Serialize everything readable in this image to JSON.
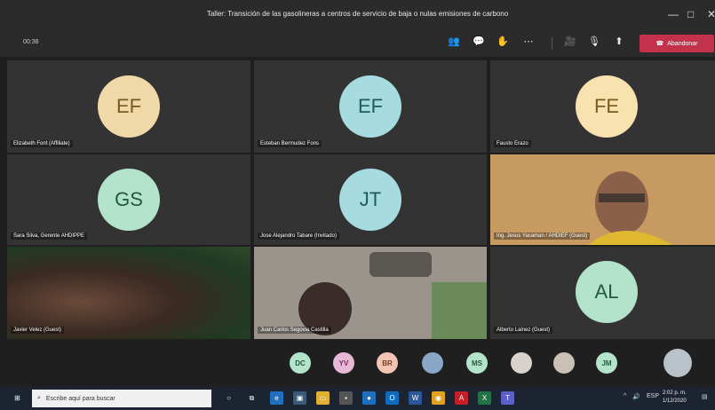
{
  "window": {
    "title": "Taller: Transición de las gasolineras a centros de servicio de baja o nulas emisiones de carbono",
    "min_glyph": "—",
    "max_glyph": "□",
    "close_glyph": "✕"
  },
  "callbar": {
    "timer": "00:38",
    "leave_label": "Abandonar",
    "leave_color": "#c4314b"
  },
  "tiles": [
    {
      "initials": "EF",
      "name": "Elizabeth Font (Affiliate)",
      "color": "#f0d9a8",
      "text_color": "#7a5a1e"
    },
    {
      "initials": "EF",
      "name": "Esteban Bermudez Fons",
      "color": "#a6dce0",
      "text_color": "#1f5a62"
    },
    {
      "initials": "FE",
      "name": "Fausto Erazo",
      "color": "#f7e2b0",
      "text_color": "#7a5a1e"
    },
    {
      "initials": "GS",
      "name": "Sara Silva, Gerente AHDIPPE",
      "color": "#b3e3cb",
      "text_color": "#215a3f"
    },
    {
      "initials": "JT",
      "name": "Jose Alejandro Tabare (Invitado)",
      "color": "#a6dce0",
      "text_color": "#1f5a62"
    },
    {
      "initials": "",
      "name": "Ing. Jesus Yacaman / AHDIEF (Guest)",
      "video": true
    },
    {
      "initials": "",
      "name": "Javier Velez (Guest)",
      "video": true
    },
    {
      "initials": "",
      "name": "Juan Carlos Segovia Castilla",
      "video": true
    },
    {
      "initials": "AL",
      "name": "Alberto Lainez (Guest)",
      "color": "#b3e3cb",
      "text_color": "#215a3f"
    }
  ],
  "strip": [
    {
      "initials": "DC",
      "color": "#b3e3cb",
      "text_color": "#215a3f"
    },
    {
      "initials": "YV",
      "color": "#e8b9d6",
      "text_color": "#7a2a5a"
    },
    {
      "initials": "BR",
      "color": "#f3c4b3",
      "text_color": "#7a3a22"
    },
    {
      "initials": "",
      "color": "#8aa7c8",
      "text_color": "#fff",
      "photo": true
    },
    {
      "initials": "MS",
      "color": "#b3e3cb",
      "text_color": "#215a3f"
    },
    {
      "initials": "",
      "color": "#d9d2cc",
      "text_color": "#fff",
      "photo": true
    },
    {
      "initials": "",
      "color": "#c9c0b6",
      "text_color": "#fff",
      "photo": true
    },
    {
      "initials": "JM",
      "color": "#b3e3cb",
      "text_color": "#215a3f"
    }
  ],
  "taskbar": {
    "search_placeholder": "Escribe aquí para buscar",
    "lang": "ESP",
    "time": "2:02 p. m.",
    "date": "1/12/2020"
  }
}
